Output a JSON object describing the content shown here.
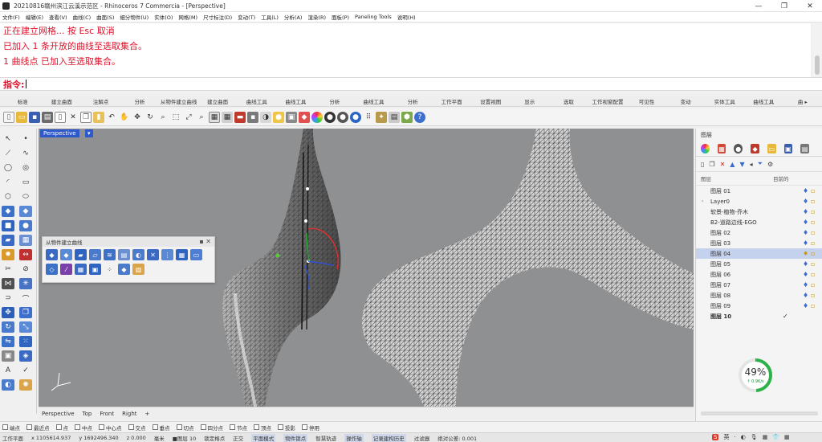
{
  "window": {
    "title": "20210816赣州滨江云溪示范区 - Rhinoceros 7 Commercia - [Perspective]",
    "minimize": "—",
    "maximize": "❐",
    "close": "✕"
  },
  "menu": [
    "文件(F)",
    "编辑(E)",
    "查看(V)",
    "曲线(C)",
    "曲面(S)",
    "细分物件(U)",
    "实体(O)",
    "网格(M)",
    "尺寸标注(D)",
    "变动(T)",
    "工具(L)",
    "分析(A)",
    "渲染(R)",
    "面板(P)",
    "Paneling Tools",
    "说明(H)"
  ],
  "command_history": [
    "正在建立网格... 按 Esc 取消",
    "已加入 1 条开放的曲线至选取集合。",
    "1 曲线点 已加入至选取集合。"
  ],
  "command_prompt": "指令:",
  "toolbar_tabs": [
    "标准",
    "建立曲面",
    "注解点",
    "分析",
    "从物件建立曲线",
    "建立曲面",
    "曲线工具",
    "曲线工具",
    "分析",
    "曲线工具",
    "分析",
    "工作平面",
    "设置视图",
    "显示",
    "选取",
    "工作视窗配置",
    "可见性",
    "变动",
    "实体工具",
    "曲线工具",
    "曲 ▸"
  ],
  "viewport": {
    "label": "Perspective",
    "label_arrow": "▾",
    "tabs": [
      "Perspective",
      "Top",
      "Front",
      "Right",
      "+"
    ],
    "background_color": "#8f9092"
  },
  "floating_palette": {
    "title": "从物件建立曲线",
    "close": "▪ ✕"
  },
  "osnaps": [
    "端点",
    "最近点",
    "点",
    "中点",
    "中心点",
    "交点",
    "垂点",
    "切点",
    "四分点",
    "节点",
    "顶点",
    "投影",
    "停用"
  ],
  "status_bar": [
    "工作平面",
    "x 1105614.937",
    "y 1692496.340",
    "z 0.000",
    "毫米",
    "■图层 10",
    "锁定格点",
    "正交",
    "平面模式",
    "物件锁点",
    "智慧轨迹",
    "操作轴",
    "记录建构历史",
    "过滤器",
    "绝对公差: 0.001"
  ],
  "layers_panel": {
    "header": "图层",
    "columns": [
      "图层",
      "目前的"
    ],
    "layers": [
      {
        "name": "图层 01",
        "selected": false,
        "has_arrow": false
      },
      {
        "name": "Layer0",
        "selected": false,
        "has_arrow": true
      },
      {
        "name": "软景-植物-乔木",
        "selected": false,
        "has_arrow": false
      },
      {
        "name": "B2-道路边线-EGO",
        "selected": false,
        "has_arrow": false
      },
      {
        "name": "图层 02",
        "selected": false,
        "has_arrow": false
      },
      {
        "name": "图层 03",
        "selected": false,
        "has_arrow": false
      },
      {
        "name": "图层 04",
        "selected": true,
        "has_arrow": false
      },
      {
        "name": "图层 05",
        "selected": false,
        "has_arrow": false
      },
      {
        "name": "图层 06",
        "selected": false,
        "has_arrow": false
      },
      {
        "name": "图层 07",
        "selected": false,
        "has_arrow": false
      },
      {
        "name": "图层 08",
        "selected": false,
        "has_arrow": false
      },
      {
        "name": "图层 09",
        "selected": false,
        "has_arrow": false
      },
      {
        "name": "图层 10",
        "selected": false,
        "has_arrow": false,
        "current": "✓"
      }
    ]
  },
  "progress": {
    "value": "49%",
    "fraction": 0.49,
    "sub": "↑ 0.9K/s"
  },
  "tray": [
    "S",
    "英",
    "·",
    "◐",
    "🎙",
    "▦",
    "👕",
    "▦"
  ],
  "colors": {
    "command_red": "#e0102a",
    "selection_blue": "#c5d2ee",
    "viewport_label": "#2f58c8",
    "progress_green": "#2db24a"
  }
}
